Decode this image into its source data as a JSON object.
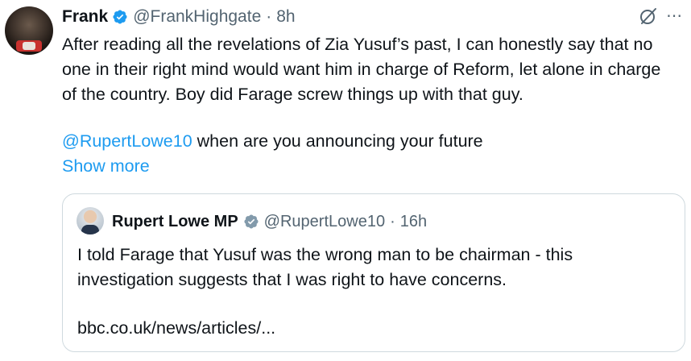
{
  "tweet": {
    "author_name": "Frank",
    "handle": "@FrankHighgate",
    "separator": "·",
    "time": "8h",
    "text": "After reading all the revelations of Zia Yusuf’s past, I can honestly say that no one in their right mind would want him in charge of Reform, let alone in charge of the country. Boy did Farage screw things up with that guy.",
    "mention": "@RupertLowe10",
    "mention_tail": " when are you announcing your future",
    "show_more": "Show more",
    "more_icon": "⋯"
  },
  "quote": {
    "author_name": "Rupert Lowe MP",
    "handle": "@RupertLowe10",
    "separator": "·",
    "time": "16h",
    "text": "I told Farage that Yusuf was the wrong man to be chairman - this investigation suggests that I was right to have concerns.",
    "link": "bbc.co.uk/news/articles/..."
  },
  "icons": {
    "verified": "verified-badge-icon",
    "grok": "grok-icon",
    "more": "more-options-icon"
  },
  "colors": {
    "link": "#1d9bf0",
    "secondary_text": "#536471",
    "primary_text": "#0f1419",
    "border": "#cfd9de",
    "verified_blue": "#1d9bf0",
    "verified_gray": "#829aab"
  }
}
